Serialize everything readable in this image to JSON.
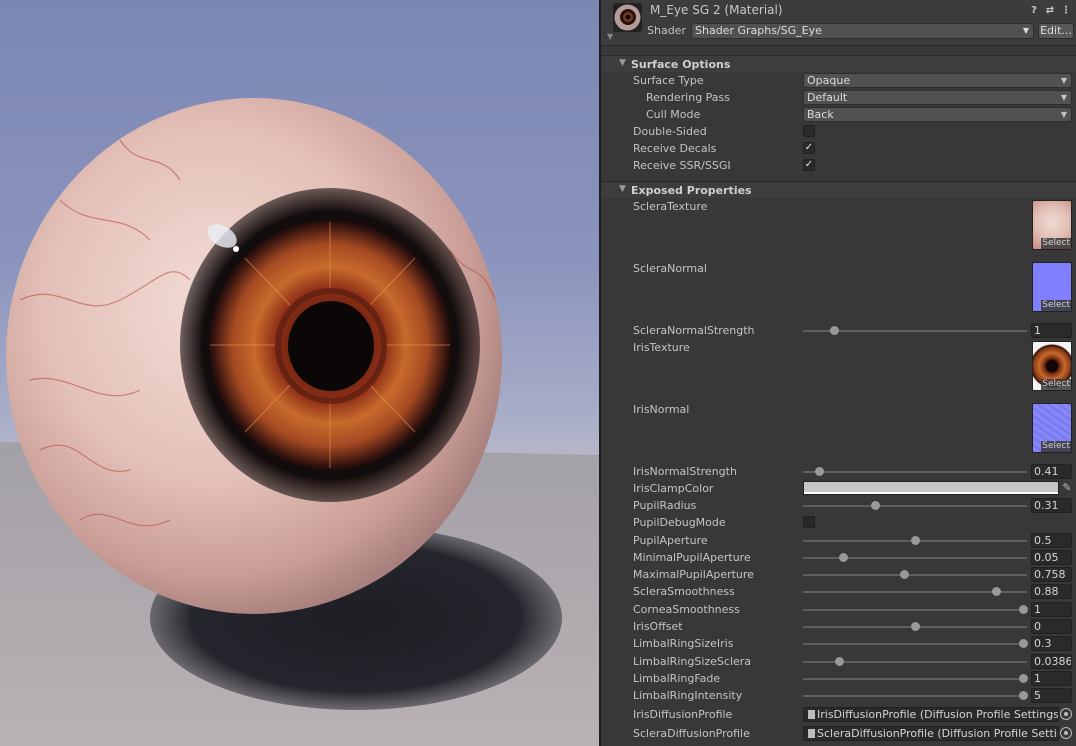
{
  "header": {
    "title": "M_Eye SG 2 (Material)",
    "shader_label": "Shader",
    "shader_value": "Shader Graphs/SG_Eye",
    "edit_label": "Edit...",
    "icons": [
      "help-icon",
      "presets-icon",
      "more-icon"
    ]
  },
  "surface": {
    "title": "Surface Options",
    "surface_type": {
      "label": "Surface Type",
      "value": "Opaque"
    },
    "rendering_pass": {
      "label": "Rendering Pass",
      "value": "Default"
    },
    "cull_mode": {
      "label": "Cull Mode",
      "value": "Back"
    },
    "double_sided": {
      "label": "Double-Sided",
      "checked": false
    },
    "receive_decals": {
      "label": "Receive Decals",
      "checked": true
    },
    "receive_ssr": {
      "label": "Receive SSR/SSGI",
      "checked": true
    }
  },
  "exposed": {
    "title": "Exposed Properties",
    "select_label": "Select",
    "sclera_texture": {
      "label": "ScleraTexture"
    },
    "sclera_normal": {
      "label": "ScleraNormal"
    },
    "sclera_normal_strength": {
      "label": "ScleraNormalStrength",
      "value": "1",
      "slider_fraction": 0.14
    },
    "iris_texture": {
      "label": "IrisTexture"
    },
    "iris_normal": {
      "label": "IrisNormal"
    },
    "iris_normal_strength": {
      "label": "IrisNormalStrength",
      "value": "0.41",
      "slider_fraction": 0.07
    },
    "iris_clamp_color": {
      "label": "IrisClampColor",
      "color": "#c6c6c6"
    },
    "pupil_radius": {
      "label": "PupilRadius",
      "value": "0.31",
      "slider_fraction": 0.32
    },
    "pupil_debug_mode": {
      "label": "PupilDebugMode",
      "checked": false
    },
    "pupil_aperture": {
      "label": "PupilAperture",
      "value": "0.5",
      "slider_fraction": 0.5
    },
    "min_pupil_aperture": {
      "label": "MinimalPupilAperture",
      "value": "0.05",
      "slider_fraction": 0.18
    },
    "max_pupil_aperture": {
      "label": "MaximalPupilAperture",
      "value": "0.758",
      "slider_fraction": 0.45
    },
    "sclera_smoothness": {
      "label": "ScleraSmoothness",
      "value": "0.88",
      "slider_fraction": 0.86
    },
    "cornea_smoothness": {
      "label": "CorneaSmoothness",
      "value": "1",
      "slider_fraction": 0.98
    },
    "iris_offset": {
      "label": "IrisOffset",
      "value": "0",
      "slider_fraction": 0.5
    },
    "limbal_ring_size_iris": {
      "label": "LimbalRingSizeIris",
      "value": "0.3",
      "slider_fraction": 0.98
    },
    "limbal_ring_size_sclera": {
      "label": "LimbalRingSizeSclera",
      "value": "0.0386",
      "slider_fraction": 0.16
    },
    "limbal_ring_fade": {
      "label": "LimbalRingFade",
      "value": "1",
      "slider_fraction": 0.98
    },
    "limbal_ring_intensity": {
      "label": "LimbalRingIntensity",
      "value": "5",
      "slider_fraction": 0.98
    },
    "iris_diffusion_profile": {
      "label": "IrisDiffusionProfile",
      "value": "IrisDiffusionProfile (Diffusion Profile Settings)"
    },
    "sclera_diffusion_profile": {
      "label": "ScleraDiffusionProfile",
      "value": "ScleraDiffusionProfile (Diffusion Profile Settings)"
    }
  }
}
